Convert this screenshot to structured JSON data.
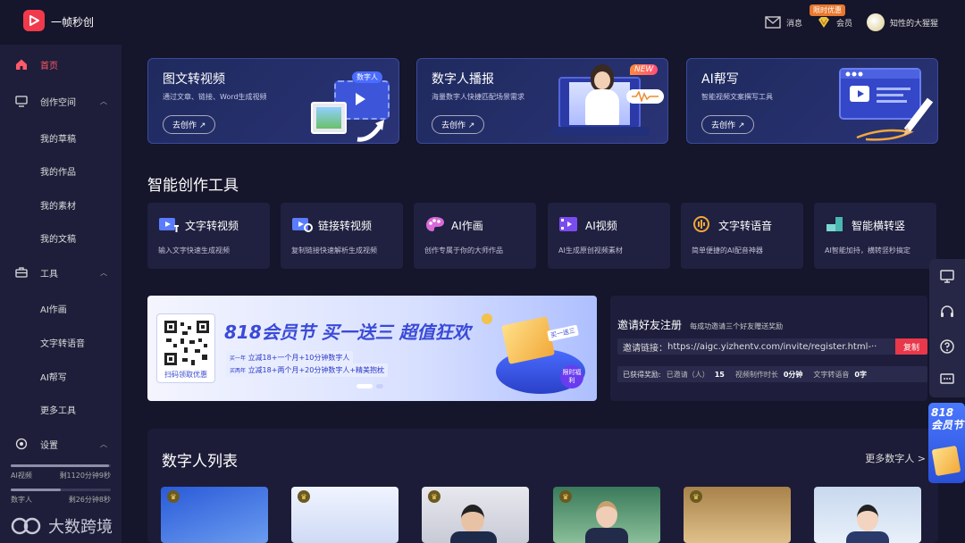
{
  "app": {
    "title": "一帧秒创"
  },
  "topbar": {
    "messages": "消息",
    "promo": "限时优惠",
    "member": "会员",
    "username": "知性的大猩猩"
  },
  "sidebar": {
    "items": [
      {
        "label": "首页"
      },
      {
        "label": "创作空间"
      },
      {
        "label": "我的草稿"
      },
      {
        "label": "我的作品"
      },
      {
        "label": "我的素材"
      },
      {
        "label": "我的文稿"
      },
      {
        "label": "工具"
      },
      {
        "label": "AI作画"
      },
      {
        "label": "文字转语音"
      },
      {
        "label": "AI帮写"
      },
      {
        "label": "更多工具"
      },
      {
        "label": "设置"
      }
    ],
    "quota": [
      {
        "name": "AI视频",
        "remaining": "剩1120分钟9秒",
        "level": 0.98
      },
      {
        "name": "数字人",
        "remaining": "剩26分钟8秒",
        "level": 0.5
      }
    ],
    "watermark": "大数跨境"
  },
  "feature_cards": [
    {
      "title": "图文转视频",
      "desc": "通过文章、链接、Word生成视频",
      "button": "去创作 ↗",
      "tag": "数字人"
    },
    {
      "title": "数字人播报",
      "desc": "海量数字人快捷匹配场景需求",
      "button": "去创作 ↗",
      "tag": "NEW"
    },
    {
      "title": "AI帮写",
      "desc": "智能视频文案撰写工具",
      "button": "去创作 ↗"
    }
  ],
  "tools_section": {
    "title": "智能创作工具"
  },
  "tools": [
    {
      "name": "文字转视频",
      "desc": "输入文字快速生成视频"
    },
    {
      "name": "链接转视频",
      "desc": "复制链接快速解析生成视频"
    },
    {
      "name": "AI作画",
      "desc": "创作专属于你的大师作品"
    },
    {
      "name": "AI视频",
      "desc": "AI生成原创视频素材"
    },
    {
      "name": "文字转语音",
      "desc": "简单便捷的AI配音神器"
    },
    {
      "name": "智能横转竖",
      "desc": "AI智能加持，横转竖秒搞定"
    }
  ],
  "banner": {
    "headline": "818会员节 买一送三 超值狂欢",
    "qr_caption": "扫码领取优惠",
    "line1_prefix": "买一年",
    "line1": "立减18+一个月+10分钟数字人",
    "line2_prefix": "买两年",
    "line2": "立减18+两个月+20分钟数字人+精美抱枕",
    "sticker": "限时福利",
    "box_tag": "买一送三"
  },
  "invite": {
    "title": "邀请好友注册",
    "subtitle": "每成功邀请三个好友赠送奖励",
    "link_label": "邀请链接：",
    "link": "https://aigc.yizhentv.com/invite/register.html-··",
    "copy": "复制",
    "reward_label": "已获得奖励:",
    "invited_label": "已邀请（人）",
    "invited_value": "15",
    "video_label": "视频制作时长",
    "video_value": "0分钟",
    "tts_label": "文字转语音",
    "tts_value": "0字"
  },
  "digital_humans": {
    "title": "数字人列表",
    "more": "更多数字人 >"
  },
  "side_promo": {
    "text": "818会员节"
  },
  "colors": {
    "accent": "#f03a4c",
    "background": "#15152b",
    "card": "#2a3375",
    "link": "#ff5a6a"
  }
}
